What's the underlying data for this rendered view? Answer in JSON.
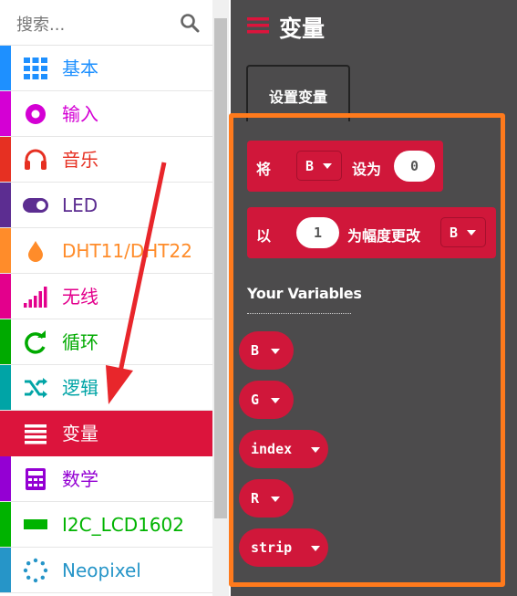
{
  "search": {
    "placeholder": "搜索...",
    "icon": "search-icon"
  },
  "categories": [
    {
      "label": "基本",
      "color": "#1e90ff",
      "icon": "grid-icon"
    },
    {
      "label": "输入",
      "color": "#d400d4",
      "icon": "radio-icon"
    },
    {
      "label": "音乐",
      "color": "#e63022",
      "icon": "headphones-icon"
    },
    {
      "label": "LED",
      "color": "#5c2d91",
      "icon": "toggle-icon"
    },
    {
      "label": "DHT11/DHT22",
      "color": "#ff8c2a",
      "icon": "drop-icon"
    },
    {
      "label": "无线",
      "color": "#e3008c",
      "icon": "signal-bars-icon"
    },
    {
      "label": "循环",
      "color": "#00aa00",
      "icon": "refresh-icon"
    },
    {
      "label": "逻辑",
      "color": "#00a4a6",
      "icon": "shuffle-icon"
    },
    {
      "label": "变量",
      "color": "#dc143c",
      "icon": "list-icon",
      "selected": true
    },
    {
      "label": "数学",
      "color": "#9400d3",
      "icon": "calculator-icon"
    },
    {
      "label": "I2C_LCD1602",
      "color": "#00b300",
      "icon": "rectangle-icon"
    },
    {
      "label": "Neopixel",
      "color": "#2695c8",
      "icon": "dots-circle-icon"
    }
  ],
  "flyout": {
    "title": "变量",
    "create_button": "设置变量",
    "set_block": {
      "prefix": "将",
      "var": "B",
      "middle": "设为",
      "value": "0"
    },
    "change_block": {
      "prefix": "以",
      "value": "1",
      "middle": "为幅度更改",
      "var": "B"
    },
    "your_variables": "Your Variables",
    "variables": [
      "B",
      "G",
      "index",
      "R",
      "strip"
    ]
  },
  "colors": {
    "flyout_bg": "#4c4b4c",
    "block": "#d0173a",
    "highlight": "#ff7a1c",
    "arrow": "#e8262b"
  }
}
